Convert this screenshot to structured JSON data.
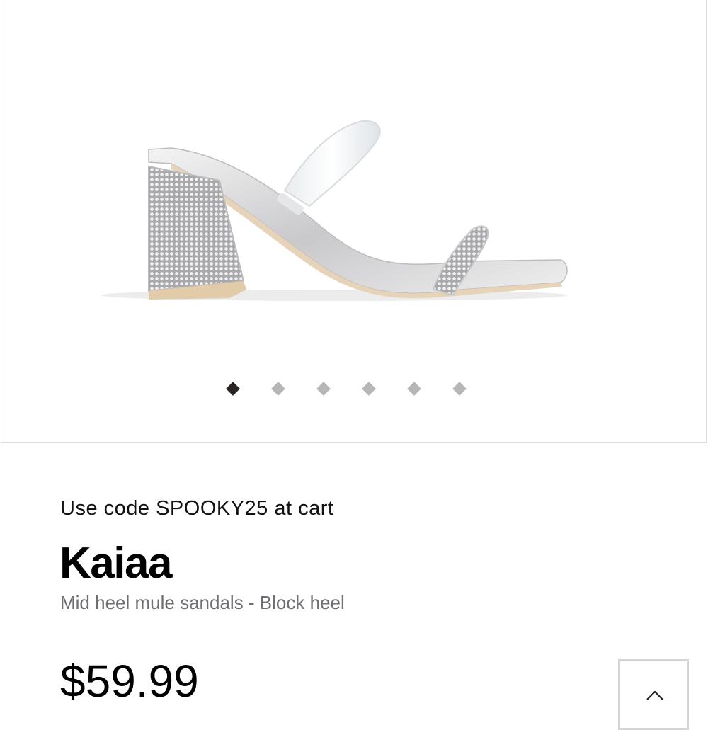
{
  "gallery": {
    "image_icon": "sandal-product-image",
    "slide_count": 6,
    "active_slide": 1
  },
  "product": {
    "promo": "Use code SPOOKY25 at cart",
    "name": "Kaiaa",
    "description": "Mid heel mule sandals - Block heel",
    "price": "$59.99"
  },
  "controls": {
    "scroll_top_icon": "chevron-up-icon"
  },
  "colors": {
    "active_dot": "#2b2424",
    "inactive_dot": "#b6b6b6",
    "subtitle": "#6e6e76"
  }
}
